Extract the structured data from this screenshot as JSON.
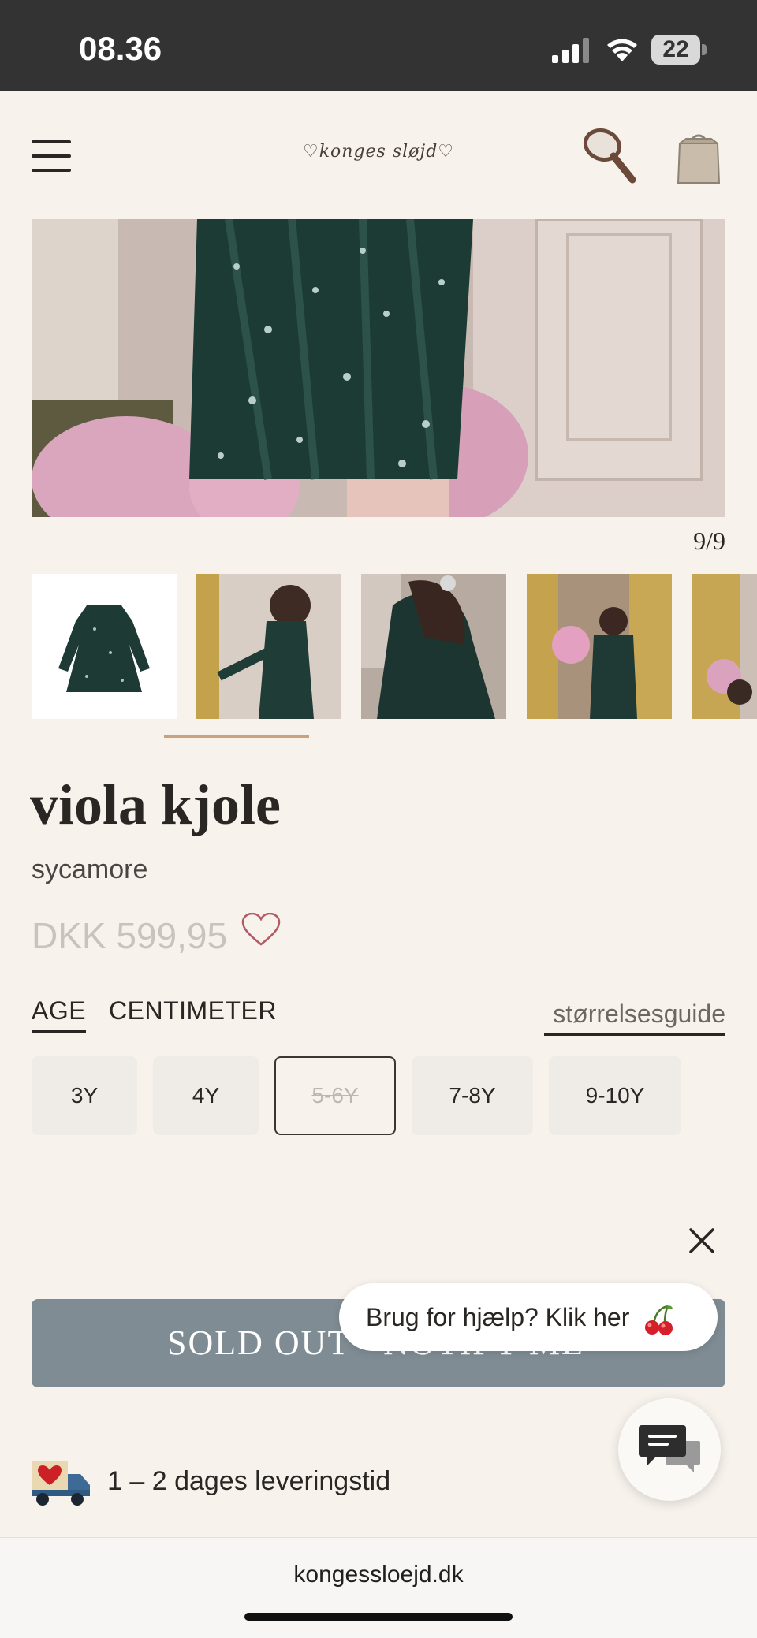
{
  "status_bar": {
    "time": "08.36",
    "battery": "22"
  },
  "header": {
    "logo": "♡konges sløjd♡"
  },
  "gallery": {
    "counter": "9/9"
  },
  "product": {
    "title": "viola kjole",
    "color": "sycamore",
    "price": "DKK 599,95"
  },
  "size_tabs": [
    {
      "label": "AGE",
      "active": true
    },
    {
      "label": "CENTIMETER",
      "active": false
    }
  ],
  "size_guide": "størrelsesguide",
  "sizes": [
    {
      "label": "3Y",
      "selected": false
    },
    {
      "label": "4Y",
      "selected": false
    },
    {
      "label": "5-6Y",
      "selected": true
    },
    {
      "label": "7-8Y",
      "selected": false
    },
    {
      "label": "9-10Y",
      "selected": false
    }
  ],
  "sold_out_button": "SOLD OUT - NOTIFY ME",
  "help_bubble": "Brug for hjælp? Klik her",
  "delivery": "1 – 2 dages leveringstid",
  "browser": {
    "domain": "kongessloejd.dk"
  },
  "colors": {
    "sold_out_button": "#7f8c93",
    "active_thumb_bar": "#c9a27d",
    "background": "#f7f2ec"
  },
  "icons": [
    "menu-icon",
    "search-icon",
    "bag-icon",
    "heart-icon",
    "close-icon",
    "cherry-icon",
    "chat-icon",
    "truck-icon"
  ]
}
